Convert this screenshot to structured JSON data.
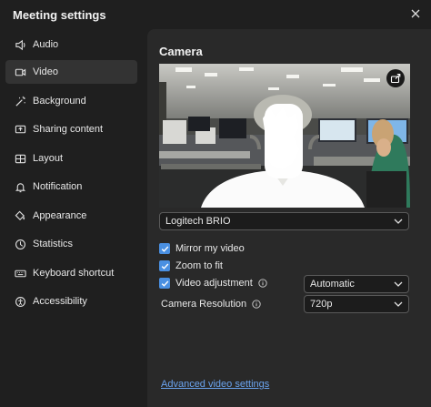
{
  "window": {
    "title": "Meeting settings"
  },
  "sidebar": {
    "items": [
      {
        "label": "Audio",
        "icon": "speaker-icon"
      },
      {
        "label": "Video",
        "icon": "video-camera-icon",
        "active": true
      },
      {
        "label": "Background",
        "icon": "magic-wand-icon"
      },
      {
        "label": "Sharing content",
        "icon": "share-screen-icon"
      },
      {
        "label": "Layout",
        "icon": "layout-grid-icon"
      },
      {
        "label": "Notification",
        "icon": "bell-icon"
      },
      {
        "label": "Appearance",
        "icon": "paint-bucket-icon"
      },
      {
        "label": "Statistics",
        "icon": "statistics-icon"
      },
      {
        "label": "Keyboard shortcut",
        "icon": "keyboard-icon"
      },
      {
        "label": "Accessibility",
        "icon": "accessibility-icon"
      }
    ]
  },
  "camera": {
    "heading": "Camera",
    "device": "Logitech BRIO",
    "options": [
      {
        "label": "Mirror my video",
        "checked": true
      },
      {
        "label": "Zoom to fit",
        "checked": true
      },
      {
        "label": "Video adjustment",
        "checked": true
      }
    ],
    "video_adjustment_value": "Automatic",
    "resolution_label": "Camera Resolution",
    "resolution_value": "720p",
    "advanced_link": "Advanced video settings"
  },
  "colors": {
    "accent": "#4a90e2",
    "link": "#6aa3ee",
    "panel": "#292929",
    "background": "#1f1f1f"
  }
}
